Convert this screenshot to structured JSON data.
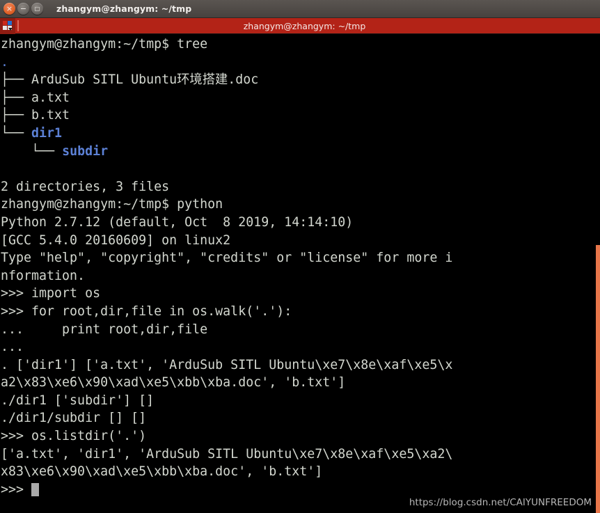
{
  "titlebar": {
    "title": "zhangym@zhangym: ~/tmp",
    "close_glyph": "×",
    "minimize_glyph": "−",
    "maximize_glyph": "□"
  },
  "tabbar": {
    "tab_title": "zhangym@zhangym: ~/tmp"
  },
  "terminal": {
    "prompt": "zhangym@zhangym:~/tmp$ ",
    "lines": [
      {
        "id": "cmd-tree",
        "text": "zhangym@zhangym:~/tmp$ tree"
      },
      {
        "id": "tree-root",
        "text": "."
      },
      {
        "id": "tree-file-doc",
        "text": "├── ArduSub SITL Ubuntu环境搭建.doc"
      },
      {
        "id": "tree-file-a",
        "text": "├── a.txt"
      },
      {
        "id": "tree-file-b",
        "text": "├── b.txt"
      },
      {
        "id": "tree-dir-dir1",
        "text": "└── dir1"
      },
      {
        "id": "tree-dir-subdir",
        "text": "    └── subdir"
      },
      {
        "id": "blank-1",
        "text": ""
      },
      {
        "id": "tree-summary",
        "text": "2 directories, 3 files"
      },
      {
        "id": "cmd-python",
        "text": "zhangym@zhangym:~/tmp$ python"
      },
      {
        "id": "py-banner-1",
        "text": "Python 2.7.12 (default, Oct  8 2019, 14:14:10)"
      },
      {
        "id": "py-banner-2",
        "text": "[GCC 5.4.0 20160609] on linux2"
      },
      {
        "id": "py-banner-3",
        "text": "Type \"help\", \"copyright\", \"credits\" or \"license\" for more i"
      },
      {
        "id": "py-banner-4",
        "text": "nformation."
      },
      {
        "id": "py-import-os",
        "text": ">>> import os"
      },
      {
        "id": "py-for-walk",
        "text": ">>> for root,dir,file in os.walk('.'):"
      },
      {
        "id": "py-print",
        "text": "...     print root,dir,file"
      },
      {
        "id": "py-cont-blank",
        "text": "... "
      },
      {
        "id": "walk-out-1a",
        "text": ". ['dir1'] ['a.txt', 'ArduSub SITL Ubuntu\\xe7\\x8e\\xaf\\xe5\\x"
      },
      {
        "id": "walk-out-1b",
        "text": "a2\\x83\\xe6\\x90\\xad\\xe5\\xbb\\xba.doc', 'b.txt']"
      },
      {
        "id": "walk-out-2",
        "text": "./dir1 ['subdir'] []"
      },
      {
        "id": "walk-out-3",
        "text": "./dir1/subdir [] []"
      },
      {
        "id": "py-listdir",
        "text": ">>> os.listdir('.')"
      },
      {
        "id": "listdir-out-a",
        "text": "['a.txt', 'dir1', 'ArduSub SITL Ubuntu\\xe7\\x8e\\xaf\\xe5\\xa2\\"
      },
      {
        "id": "listdir-out-b",
        "text": "x83\\xe6\\x90\\xad\\xe5\\xbb\\xba.doc', 'b.txt']"
      },
      {
        "id": "py-final-prompt",
        "text": ">>> "
      }
    ],
    "colors": {
      "background": "#000000",
      "foreground": "#d3d7cf",
      "directory": "#5c81d6",
      "cursor": "#aaaaaa"
    }
  },
  "scrollbar": {
    "thumb_color": "#e8764a"
  },
  "watermark": {
    "text": "https://blog.csdn.net/CAIYUNFREEDOM"
  }
}
